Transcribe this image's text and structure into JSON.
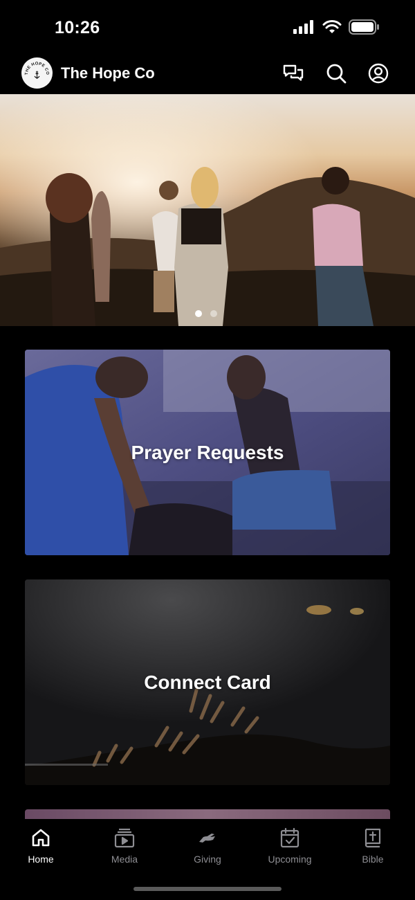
{
  "status_bar": {
    "time": "10:26",
    "icons": [
      "cellular-signal-icon",
      "wifi-icon",
      "battery-icon"
    ]
  },
  "header": {
    "title": "The Hope Co",
    "logo_text": "THE HOPE CO",
    "icons": [
      "chat-icon",
      "search-icon",
      "profile-icon"
    ]
  },
  "hero": {
    "slide_count": 2,
    "active_slide": 1
  },
  "cards": [
    {
      "label": "Prayer Requests"
    },
    {
      "label": "Connect Card"
    }
  ],
  "tabs": [
    {
      "label": "Home",
      "icon": "home-icon",
      "active": true
    },
    {
      "label": "Media",
      "icon": "media-icon",
      "active": false
    },
    {
      "label": "Giving",
      "icon": "giving-icon",
      "active": false
    },
    {
      "label": "Upcoming",
      "icon": "calendar-icon",
      "active": false
    },
    {
      "label": "Bible",
      "icon": "bible-icon",
      "active": false
    }
  ],
  "colors": {
    "background": "#000000",
    "active_tab": "#ffffff",
    "inactive_tab": "#8e8e93"
  }
}
